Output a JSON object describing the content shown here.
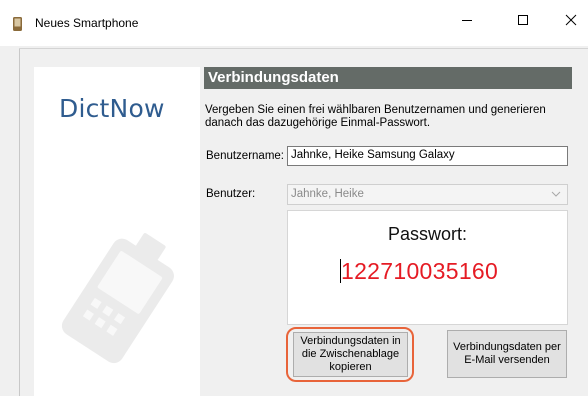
{
  "window": {
    "title": "Neues Smartphone",
    "icon": "phone-icon"
  },
  "brand": {
    "name": "DictNow",
    "color": "#2f5c8f"
  },
  "section": {
    "header": "Verbindungsdaten",
    "intro": "Vergeben Sie einen frei wählbaren Benutzernamen und generieren danach das dazugehörige Einmal-Passwort."
  },
  "form": {
    "username_label": "Benutzername:",
    "username_value": "Jahnke, Heike Samsung Galaxy",
    "user_label": "Benutzer:",
    "user_value": "Jahnke, Heike"
  },
  "password": {
    "label": "Passwort:",
    "value": "122710035160",
    "color": "#e51b24"
  },
  "buttons": {
    "copy": "Verbindungsdaten in die Zwischenablage kopieren",
    "mail": "Verbindungsdaten per E-Mail versenden"
  },
  "colors": {
    "header_bg": "#646b67",
    "highlight": "#e8643a"
  }
}
